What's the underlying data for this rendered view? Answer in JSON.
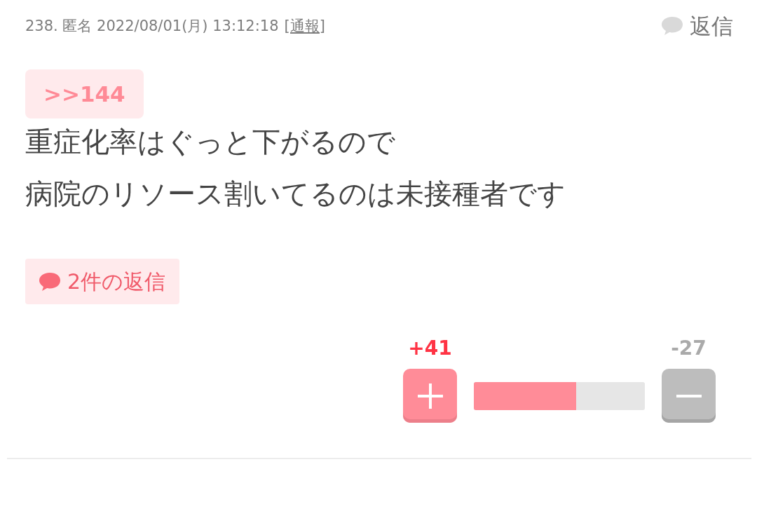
{
  "comment": {
    "meta": "238. 匿名 2022/08/01(月) 13:12:18",
    "report_link": "[通報]",
    "reply_button": "返信",
    "anchor": ">>144",
    "body": [
      "重症化率はぐっと下がるので",
      "病院のリソース割いてるのは未接種者です"
    ],
    "replies_button": "2件の返信",
    "votes": {
      "plus_count": "+41",
      "minus_count": "-27",
      "level": 0.6
    }
  }
}
